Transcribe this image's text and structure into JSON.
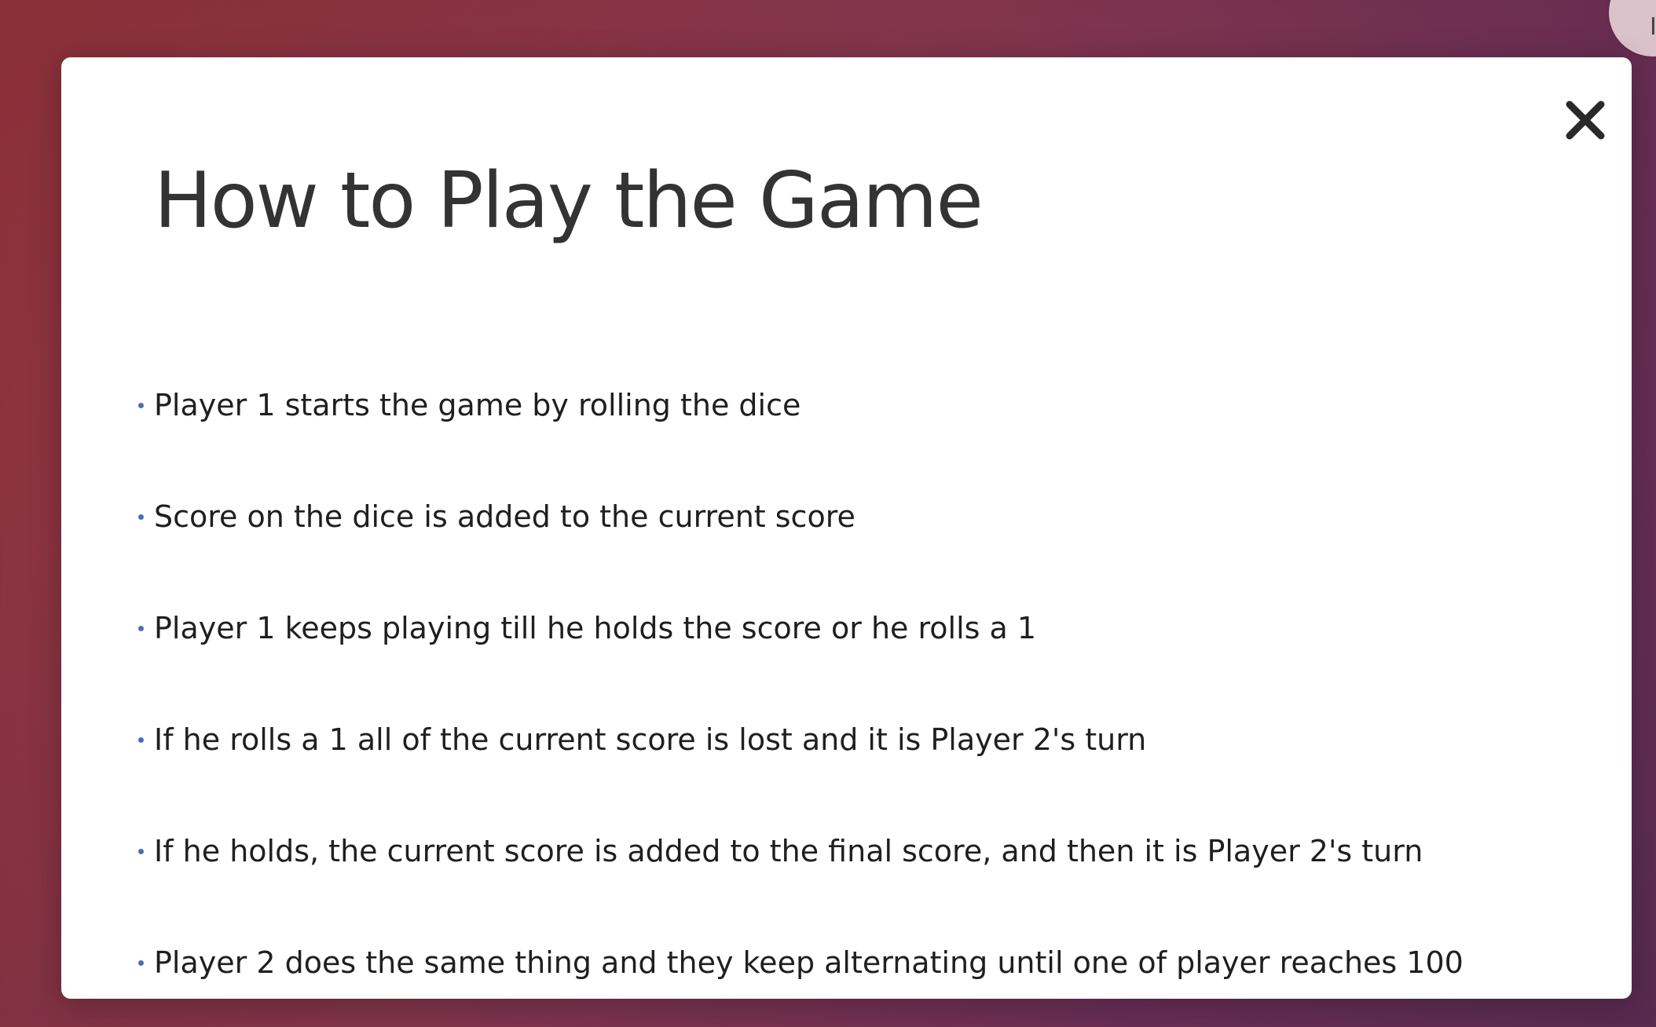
{
  "corner_button": {
    "label": "I"
  },
  "modal": {
    "close_icon": "close-icon",
    "title": "How to Play the Game",
    "rules": [
      "Player 1 starts the game by rolling the dice",
      "Score on the dice is added to the current score",
      "Player 1 keeps playing till he holds the score or he rolls a 1",
      "If he rolls a 1 all of the current score is lost and it is Player 2's turn",
      "If he holds, the current score is added to the final score, and then it is Player 2's turn",
      "Player 2 does the same thing and they keep alternating until one of player reaches 100"
    ]
  },
  "colors": {
    "background_start": "#a83a43",
    "background_end": "#68335f",
    "modal_background": "#ffffff",
    "title_text": "#333333",
    "body_text": "#1f1f1f",
    "bullet": "#4a6fb4"
  }
}
